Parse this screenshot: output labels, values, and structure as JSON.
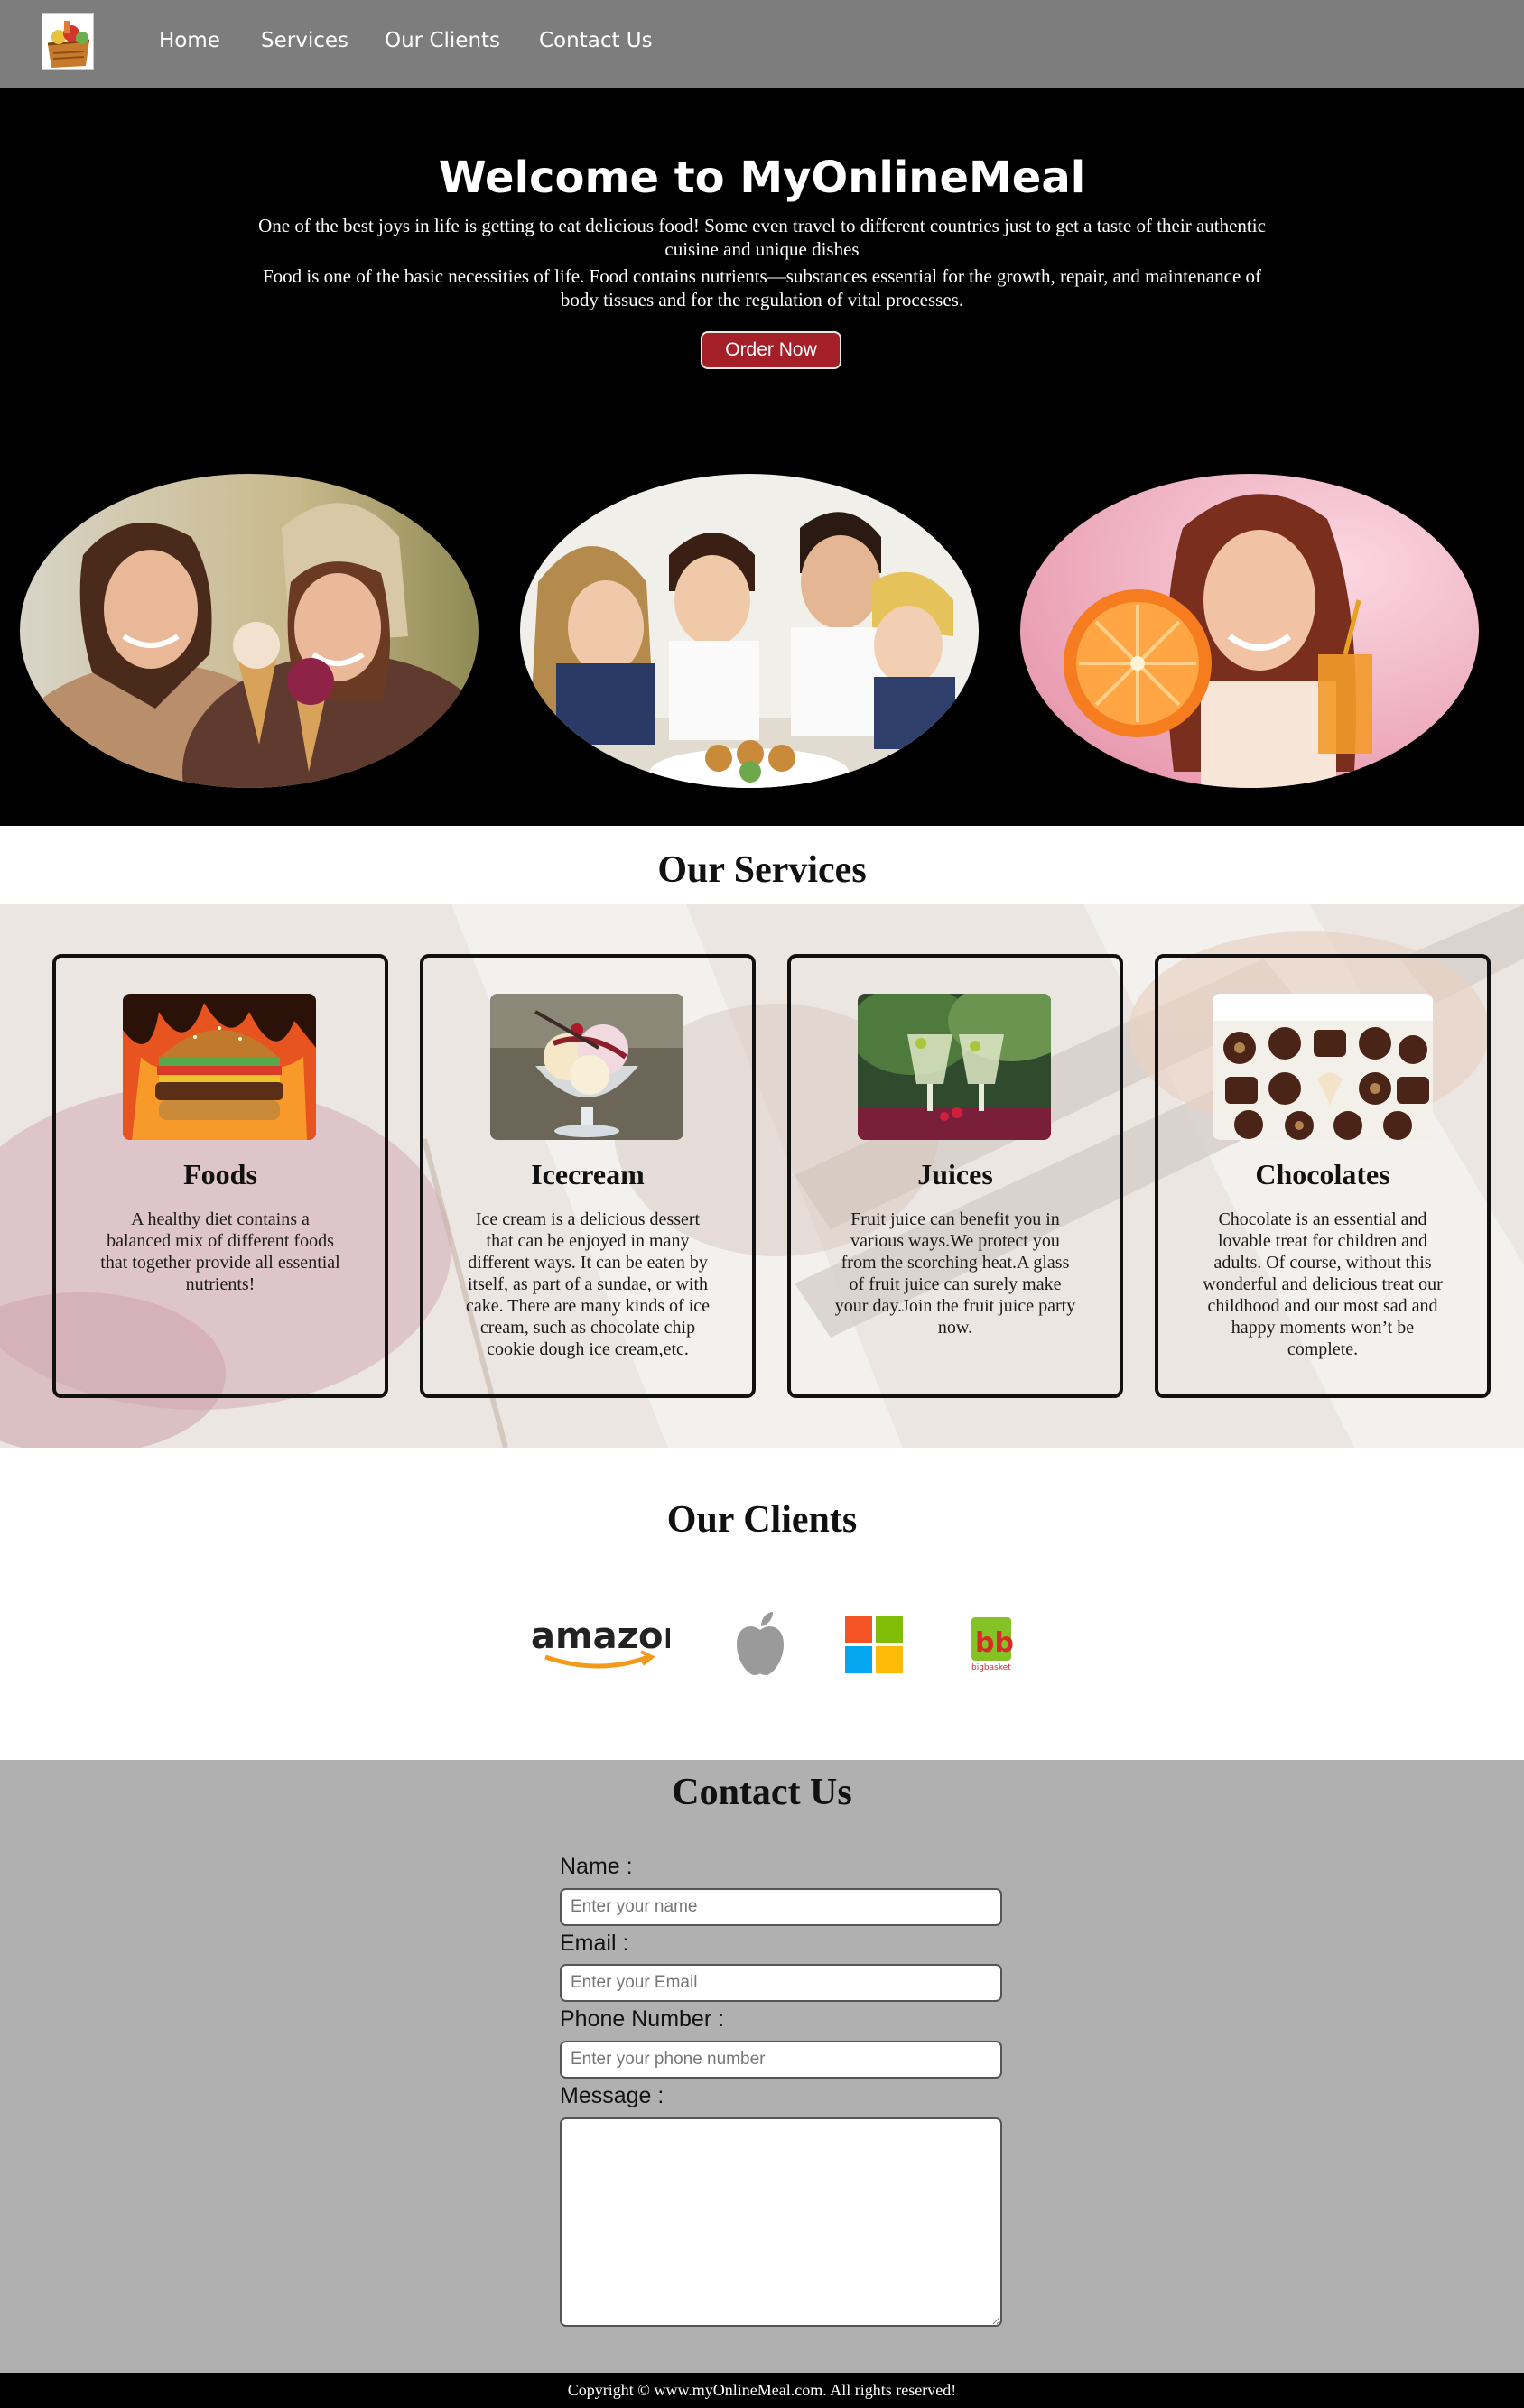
{
  "nav": {
    "logo_icon": "food-basket-icon",
    "items": [
      "Home",
      "Services",
      "Our Clients",
      "Contact Us"
    ]
  },
  "hero": {
    "title": "Welcome to MyOnlineMeal",
    "para1": "One of the best joys in life is getting to eat delicious food! Some even travel to different countries just to get a taste of their authentic cuisine and unique dishes",
    "para2": "Food is one of the basic necessities of life. Food contains nutrients—substances essential for the growth, repair, and maintenance of body tissues and for the regulation of vital processes.",
    "button": "Order Now",
    "photos": [
      "friends-eating-ice-cream-photo",
      "family-eating-burgers-photo",
      "woman-with-orange-juice-photo"
    ],
    "button_color": "#a41f27"
  },
  "services": {
    "title": "Our Services",
    "cards": [
      {
        "title": "Foods",
        "text": "A healthy diet contains a balanced mix of different foods that together provide all essential nutrients!",
        "image": "burger-photo"
      },
      {
        "title": "Icecream",
        "text": "Ice cream is a delicious dessert that can be enjoyed in many different ways. It can be eaten by itself, as part of a sundae, or with cake. There are many kinds of ice cream, such as chocolate chip cookie dough ice cream,etc.",
        "image": "ice-cream-sundae-photo"
      },
      {
        "title": "Juices",
        "text": "Fruit juice can benefit you in various ways.We protect you from the scorching heat.A glass of fruit juice can surely make your day.Join the fruit juice party now.",
        "image": "juice-glasses-photo"
      },
      {
        "title": "Chocolates",
        "text": "Chocolate is an essential and lovable treat for children and adults. Of course, without this wonderful and delicious treat our childhood and our most sad and happy moments won’t be complete.",
        "image": "chocolate-box-photo"
      }
    ]
  },
  "clients": {
    "title": "Our Clients",
    "amazon": "amazon",
    "bigbasket_sub": "bigbasket",
    "bigbasket_mark": "bb",
    "logos": [
      "amazon-logo",
      "apple-logo",
      "microsoft-logo",
      "bigbasket-logo"
    ]
  },
  "contact": {
    "title": "Contact Us",
    "name_label": "Name :",
    "name_placeholder": "Enter your name",
    "email_label": "Email :",
    "email_placeholder": "Enter your Email",
    "phone_label": "Phone Number :",
    "phone_placeholder": "Enter your phone number",
    "message_label": "Message :"
  },
  "footer": {
    "text": "Copyright © www.myOnlineMeal.com. All rights reserved!"
  }
}
